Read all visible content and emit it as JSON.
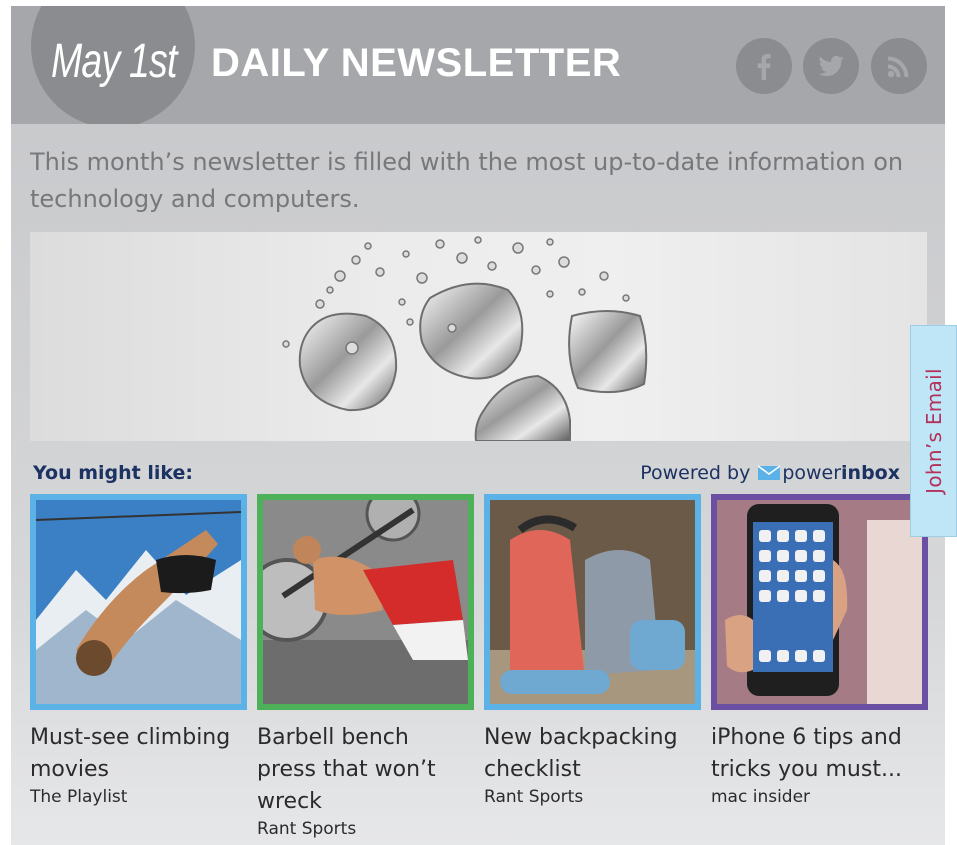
{
  "header": {
    "date": "May 1st",
    "title": "DAILY NEWSLETTER",
    "social": [
      "facebook-icon",
      "twitter-icon",
      "rss-icon"
    ]
  },
  "intro": "This month’s newsletter is filled with the most up-to-date information on technology and computers.",
  "recommendations": {
    "heading": "You might like:",
    "powered_prefix": "Powered by",
    "powered_brand_light": "power",
    "powered_brand_bold": "inbox",
    "items": [
      {
        "title": "Must-see climbing movies",
        "source": "The Playlist",
        "border": "#5ab2e6"
      },
      {
        "title": "Barbell bench press that won’t wreck",
        "source": "Rant Sports",
        "border": "#4cb158"
      },
      {
        "title": "New backpacking checklist",
        "source": "Rant Sports",
        "border": "#5ab2e6"
      },
      {
        "title": "iPhone 6 tips and tricks you must...",
        "source": "mac insider",
        "border": "#6a4fa3"
      }
    ]
  },
  "side_tab": "John’s Email",
  "colors": {
    "header_bg": "#a6a7aa",
    "accent_navy": "#1c3262",
    "tab_bg": "#bfe6f7",
    "tab_text": "#b3315a"
  }
}
